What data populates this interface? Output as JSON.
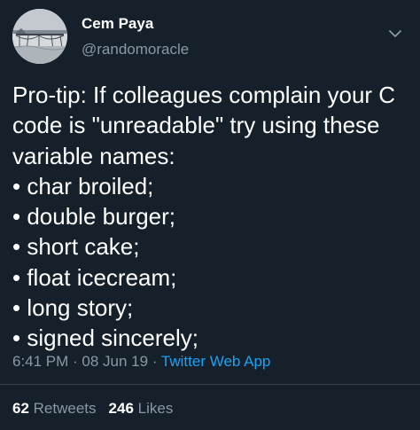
{
  "author": {
    "name": "Cem Paya",
    "handle": "@randomoracle"
  },
  "tweet": {
    "lines": [
      "Pro-tip: If colleagues complain your C",
      "code is \"unreadable\" try using these",
      "variable names:",
      "• char broiled;",
      "• double burger;",
      "• short cake;",
      "• float icecream;",
      "• long story;",
      "• signed sincerely;"
    ]
  },
  "meta": {
    "time": "6:41 PM",
    "separator": " · ",
    "date": "08 Jun 19",
    "source": "Twitter Web App"
  },
  "stats": {
    "retweets_count": "62",
    "retweets_label": "Retweets",
    "likes_count": "246",
    "likes_label": "Likes"
  },
  "colors": {
    "background": "#15202b",
    "text": "#ffffff",
    "secondary_text": "#8899a6",
    "link": "#1da1f2",
    "divider": "#38444d"
  },
  "icons": {
    "menu": "chevron-down-icon"
  }
}
